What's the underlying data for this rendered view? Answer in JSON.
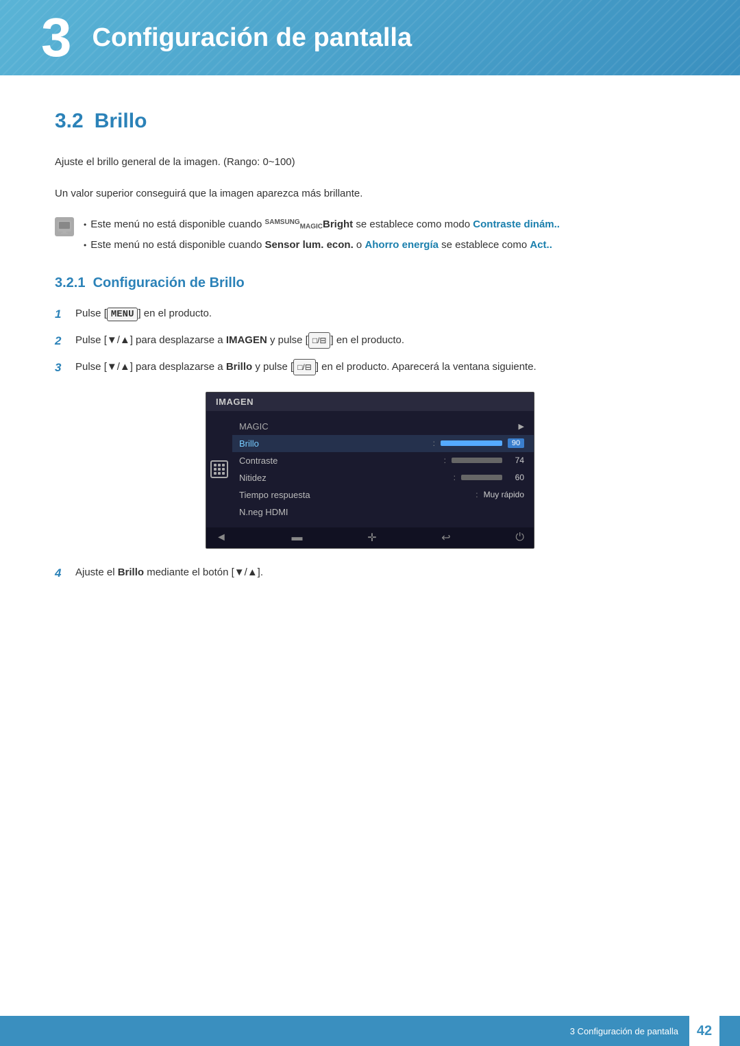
{
  "header": {
    "chapter_number": "3",
    "chapter_title": "Configuración de pantalla"
  },
  "section": {
    "number": "3.2",
    "title": "Brillo",
    "desc1": "Ajuste el brillo general de la imagen. (Rango: 0~100)",
    "desc2": "Un valor superior conseguirá que la imagen aparezca más brillante.",
    "notes": [
      "Este menú no está disponible cuando SAMSUNGBright se establece como modo Contraste dinám..",
      "Este menú no está disponible cuando Sensor lum. econ. o Ahorro energía se establece como Act.."
    ],
    "subsection": {
      "number": "3.2.1",
      "title": "Configuración de Brillo",
      "steps": [
        {
          "number": "1",
          "text": "Pulse [MENU] en el producto."
        },
        {
          "number": "2",
          "text": "Pulse [▼/▲] para desplazarse a IMAGEN y pulse [□/⊟] en el producto."
        },
        {
          "number": "3",
          "text": "Pulse [▼/▲] para desplazarse a Brillo y pulse [□/⊟] en el producto. Aparecerá la ventana siguiente."
        },
        {
          "number": "4",
          "text": "Ajuste el Brillo mediante el botón [▼/▲]."
        }
      ]
    }
  },
  "menu_screenshot": {
    "header": "IMAGEN",
    "items": [
      {
        "label": "MAGIC",
        "type": "arrow",
        "value": ""
      },
      {
        "label": "Brillo",
        "type": "bar_blue",
        "value": "90",
        "active": true
      },
      {
        "label": "Contraste",
        "type": "bar_gray",
        "value": "74"
      },
      {
        "label": "Nitidez",
        "type": "bar_gray",
        "value": "60"
      },
      {
        "label": "Tiempo respuesta",
        "type": "text",
        "value": "Muy rápido"
      },
      {
        "label": "N.neg HDMI",
        "type": "none",
        "value": ""
      }
    ]
  },
  "footer": {
    "text": "3 Configuración de pantalla",
    "page_number": "42"
  }
}
